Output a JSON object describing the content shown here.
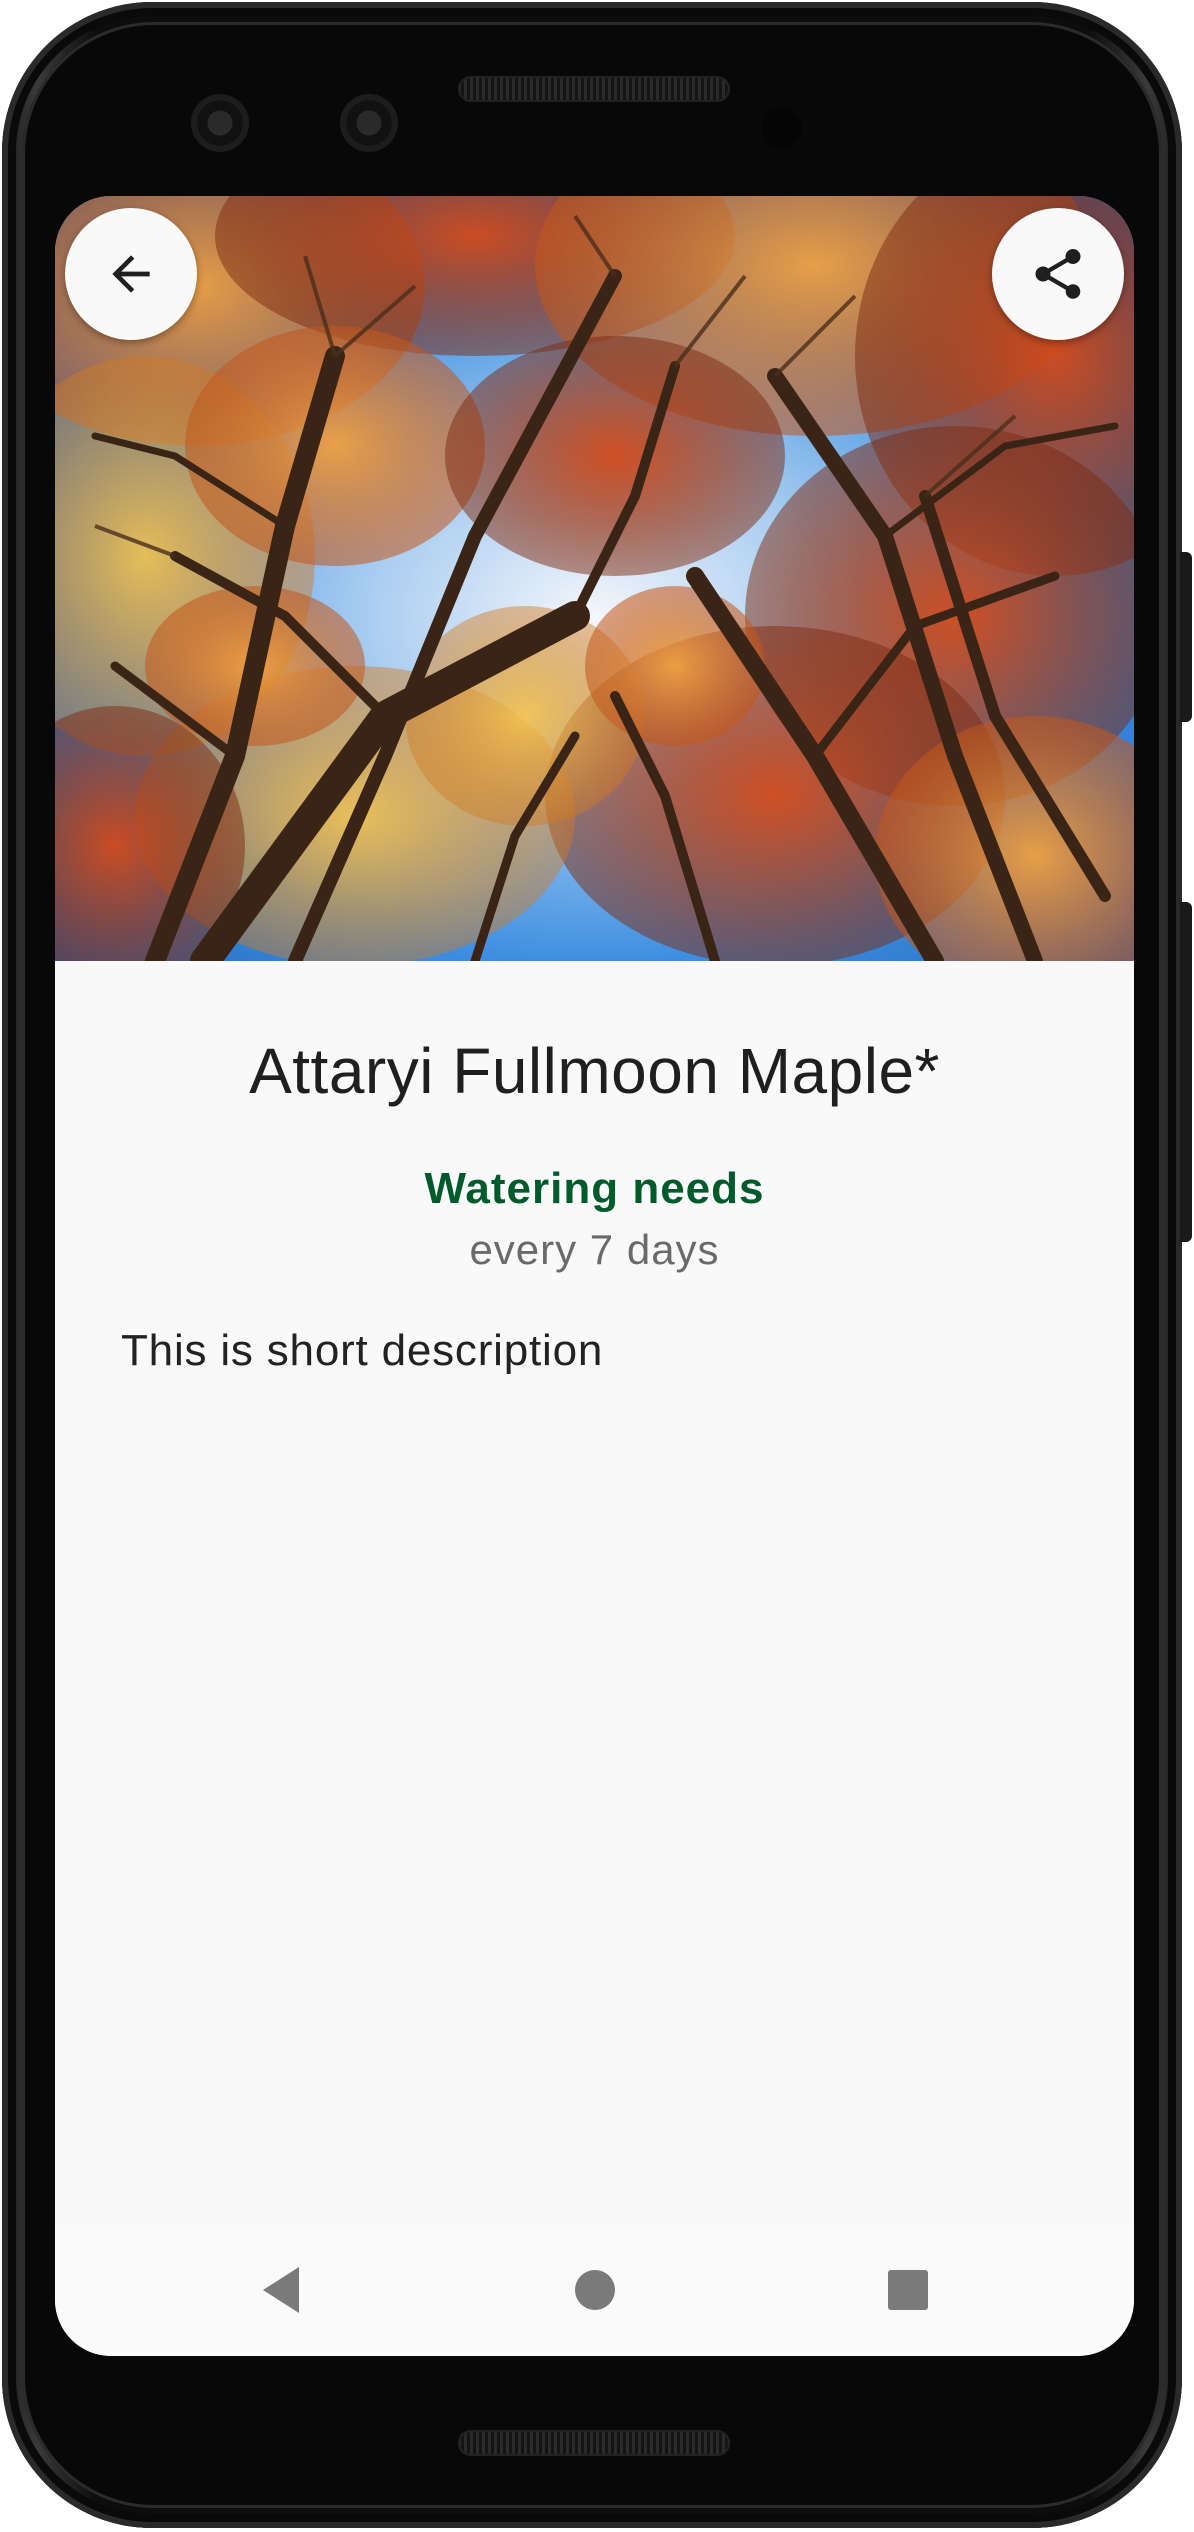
{
  "header": {
    "back_icon": "arrow-left-icon",
    "share_icon": "share-icon"
  },
  "hero_image": {
    "subject": "autumn-trees-canopy-photo"
  },
  "plant": {
    "name": "Attaryi Fullmoon Maple*",
    "watering_label": "Watering needs",
    "watering_value": "every 7 days",
    "description": "This is short description"
  },
  "navbar": {
    "back_icon": "triangle-back-icon",
    "home_icon": "circle-home-icon",
    "recents_icon": "square-recents-icon"
  },
  "colors": {
    "accent": "#005a2c",
    "title": "#1f1f1f",
    "secondary_text": "#6a6a6a",
    "background": "#f9f9f9"
  }
}
